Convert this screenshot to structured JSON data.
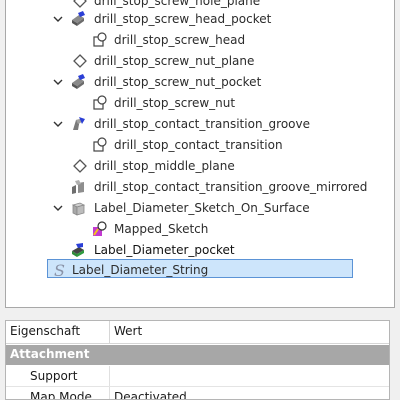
{
  "tree": {
    "items": [
      {
        "label": "drill_stop_screw_hole_plane",
        "icon": "plane-icon"
      },
      {
        "label": "drill_stop_screw_head_pocket",
        "icon": "pocket-icon"
      },
      {
        "label": "drill_stop_screw_head",
        "icon": "sketch-icon"
      },
      {
        "label": "drill_stop_screw_nut_plane",
        "icon": "plane-icon"
      },
      {
        "label": "drill_stop_screw_nut_pocket",
        "icon": "pocket-icon"
      },
      {
        "label": "drill_stop_screw_nut",
        "icon": "sketch-icon"
      },
      {
        "label": "drill_stop_contact_transition_groove",
        "icon": "groove-icon"
      },
      {
        "label": "drill_stop_contact_transition",
        "icon": "sketch-icon"
      },
      {
        "label": "drill_stop_middle_plane",
        "icon": "plane-icon"
      },
      {
        "label": "drill_stop_contact_transition_groove_mirrored",
        "icon": "mirrored-icon"
      },
      {
        "label": "Label_Diameter_Sketch_On_Surface",
        "icon": "sketch-on-surface-icon"
      },
      {
        "label": "Mapped_Sketch",
        "icon": "mapped-sketch-icon"
      },
      {
        "label": "Label_Diameter_pocket",
        "icon": "pocket-icon"
      },
      {
        "label": "Label_Diameter_String",
        "icon": "shapestring-icon"
      }
    ]
  },
  "properties": {
    "header_property": "Eigenschaft",
    "header_value": "Wert",
    "group": "Attachment",
    "rows": [
      {
        "key": "Support",
        "value": ""
      },
      {
        "key": "Map Mode",
        "value": "Deactivated"
      }
    ]
  }
}
